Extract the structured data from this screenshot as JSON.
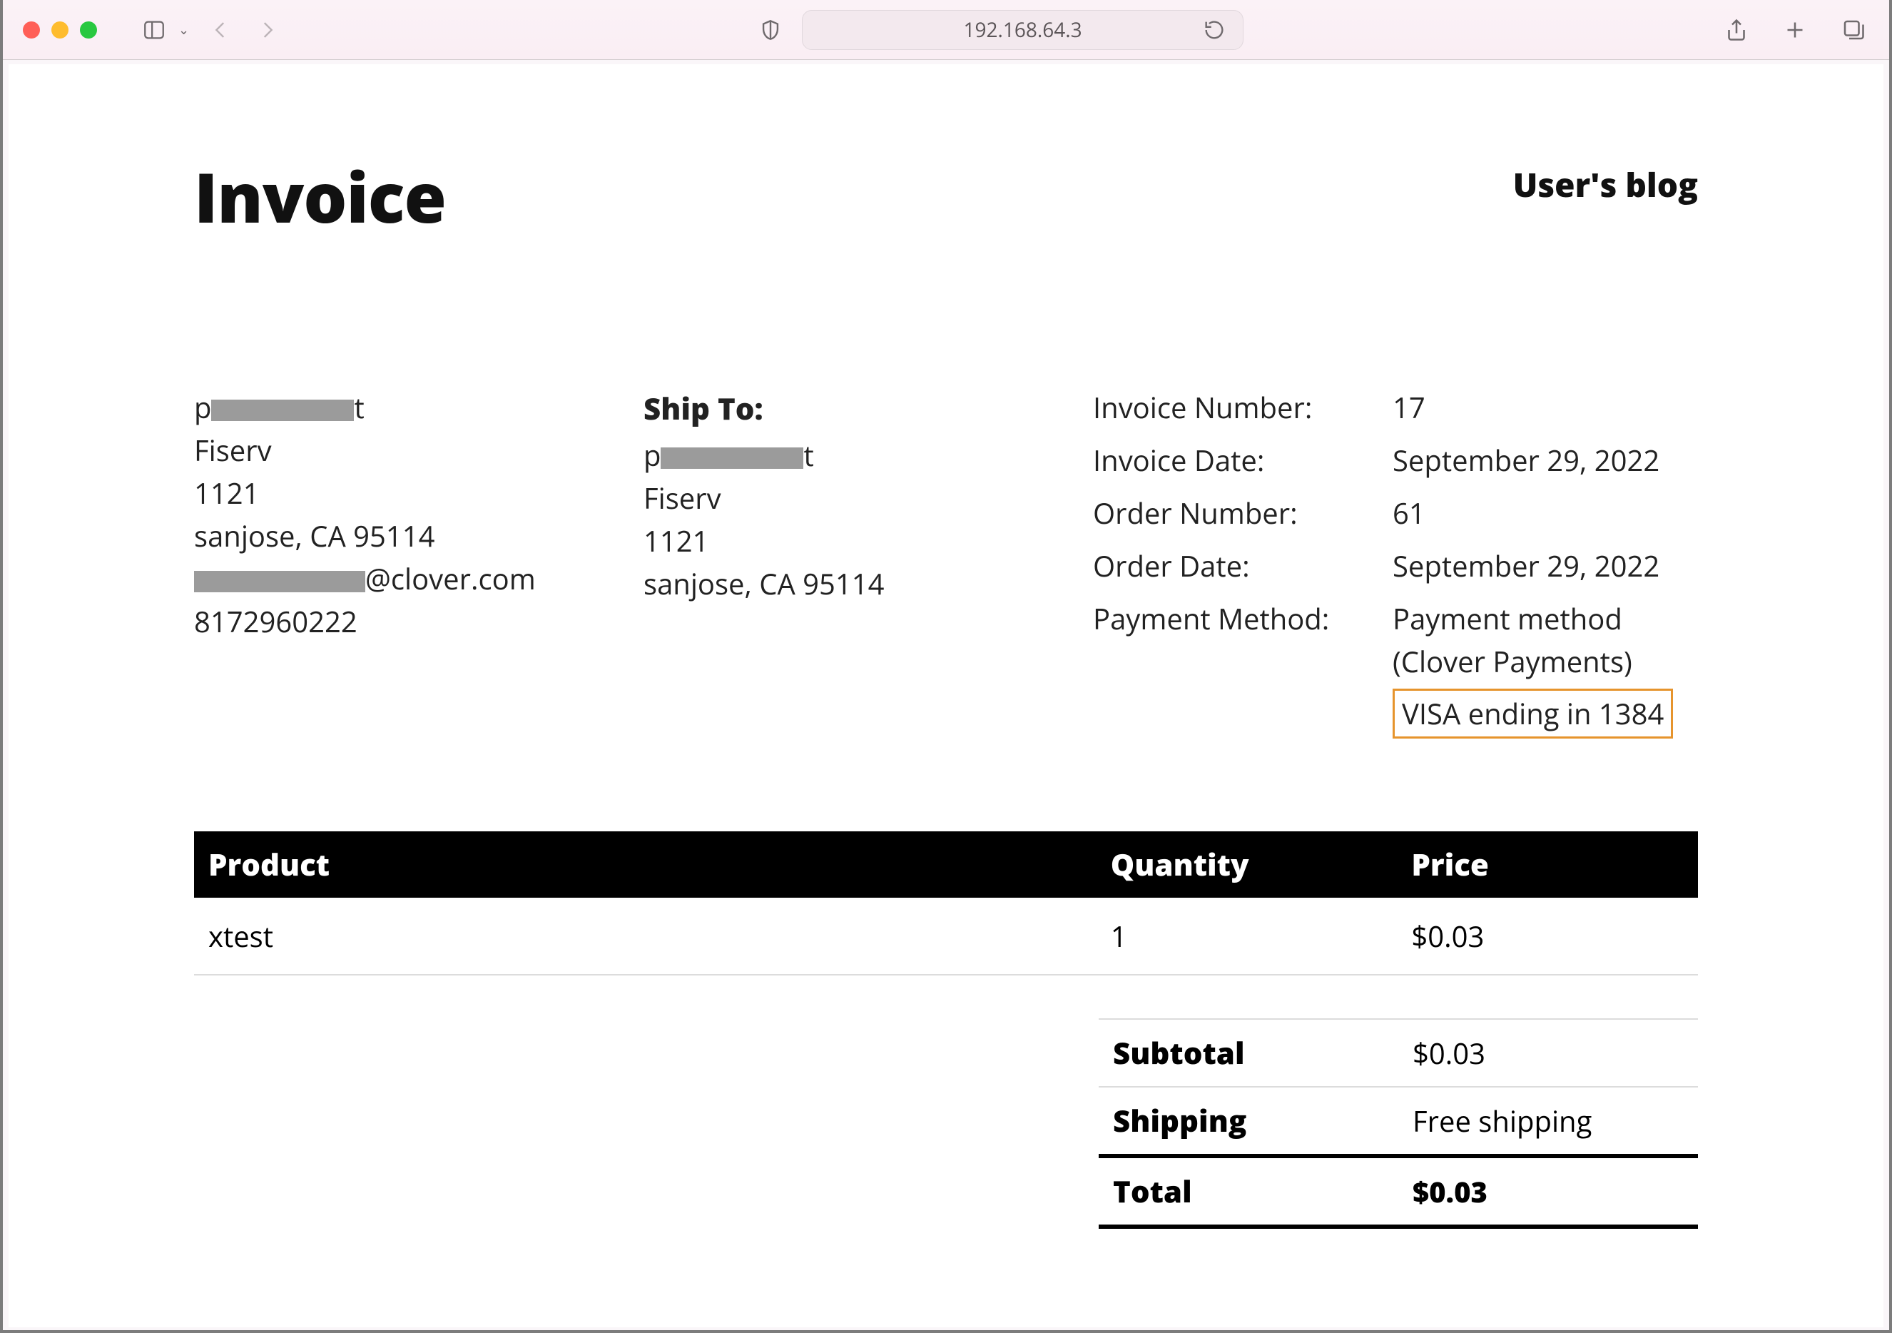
{
  "browser": {
    "address": "192.168.64.3"
  },
  "header": {
    "invoice_title": "Invoice",
    "site_title": "User's blog"
  },
  "bill_to": {
    "name_redacted": "p██████████t",
    "company": "Fiserv",
    "street": "1121",
    "city_state_zip": "sanjose, CA 95114",
    "email_redacted": "███████████@clover.com",
    "phone": "8172960222"
  },
  "ship_to": {
    "label": "Ship To:",
    "name_redacted": "p██████████t",
    "company": "Fiserv",
    "street": "1121",
    "city_state_zip": "sanjose, CA 95114"
  },
  "meta": {
    "labels": {
      "invoice_number": "Invoice Number:",
      "invoice_date": "Invoice Date:",
      "order_number": "Order Number:",
      "order_date": "Order Date:",
      "payment_method": "Payment Method:"
    },
    "values": {
      "invoice_number": "17",
      "invoice_date": "September 29, 2022",
      "order_number": "61",
      "order_date": "September 29, 2022",
      "payment_method": "Payment method (Clover Payments)",
      "card_summary": "VISA ending in 1384"
    }
  },
  "table": {
    "headers": {
      "product": "Product",
      "quantity": "Quantity",
      "price": "Price"
    },
    "rows": [
      {
        "product": "xtest",
        "quantity": "1",
        "price": "$0.03"
      }
    ]
  },
  "totals": {
    "subtotal_label": "Subtotal",
    "subtotal_value": "$0.03",
    "shipping_label": "Shipping",
    "shipping_value": "Free shipping",
    "total_label": "Total",
    "total_value": "$0.03"
  }
}
